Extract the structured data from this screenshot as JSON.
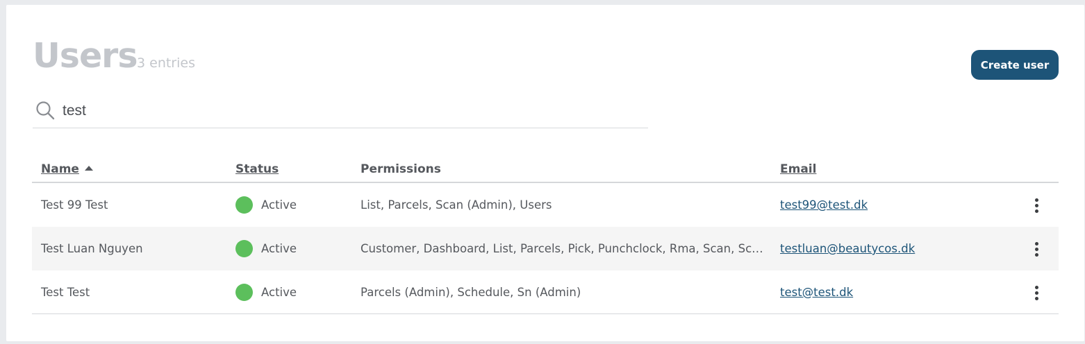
{
  "header": {
    "title": "Users",
    "entries": "3 entries",
    "create_label": "Create user"
  },
  "search": {
    "value": "test",
    "icon": "search-icon"
  },
  "table": {
    "columns": {
      "name": "Name",
      "status": "Status",
      "permissions": "Permissions",
      "email": "Email"
    },
    "sort": {
      "column": "name",
      "direction": "ascending"
    },
    "rows": [
      {
        "name": "Test 99 Test",
        "status": "Active",
        "permissions": "List, Parcels, Scan (Admin), Users",
        "email": "test99@test.dk"
      },
      {
        "name": "Test Luan Nguyen",
        "status": "Active",
        "permissions": "Customer, Dashboard, List, Parcels, Pick, Punchclock, Rma, Scan, Sch…",
        "email": "testluan@beautycos.dk"
      },
      {
        "name": "Test Test",
        "status": "Active",
        "permissions": "Parcels (Admin), Schedule, Sn (Admin)",
        "email": "test@test.dk"
      }
    ]
  },
  "colors": {
    "primary": "#1d5478",
    "status_active": "#5cbf5c",
    "title_gray": "#c3c6cb"
  }
}
